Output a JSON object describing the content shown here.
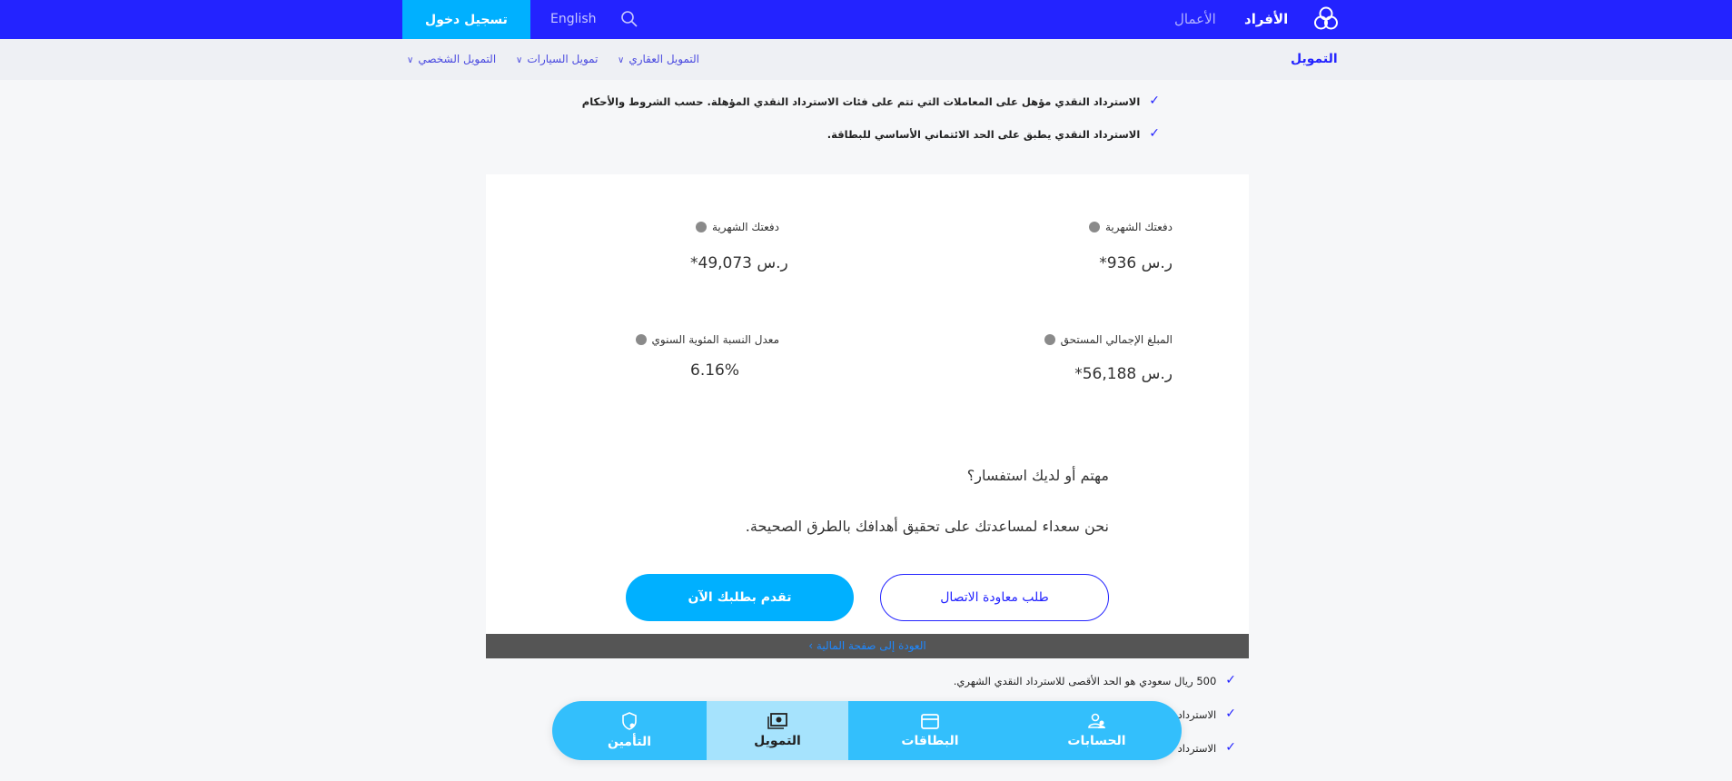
{
  "header": {
    "login": "تسجيل دخول",
    "language": "English",
    "tabs": [
      "الأفراد",
      "الأعمال"
    ]
  },
  "subnav": {
    "title": "التمويل",
    "items": [
      "التمويل العقاري",
      "تمويل السيارات",
      "التمويل الشخصي"
    ]
  },
  "top_bullets": [
    "الاسترداد النقدي مؤهل على المعاملات التي تتم على فئات الاسترداد النقدي المؤهلة. حسب الشروط والأحكام",
    "الاسترداد النقدي يطبق على الحد الائتماني الأساسي للبطاقة."
  ],
  "results": {
    "monthly_label": "دفعتك الشهرية",
    "monthly_value": "ر.س 936*",
    "monthly_label_2": "دفعتك الشهرية",
    "monthly_value_2": "ر.س 49,073*",
    "total_label": "المبلغ الإجمالي المستحق",
    "total_value": "ر.س 56,188*",
    "apr_label": "معدل النسبة المئوية السنوي",
    "apr_value": "6.16%"
  },
  "cta": {
    "question": "مهتم أو لديك استفسار؟",
    "text": "نحن سعداء لمساعدتك على تحقيق أهدافك بالطرق الصحيحة.",
    "callback": "طلب معاودة الاتصال",
    "apply": "تقدم بطلبك الآن"
  },
  "back_link": "العودة إلى صفحة المالية ›",
  "bottom_bullets": [
    "500 ريال سعودي هو الحد الأقصى للاسترداد النقدي الشهري.",
    "الاسترداد",
    "الاسترداد"
  ],
  "bottom_nav": {
    "items": [
      {
        "label": "الحسابات",
        "icon": "accounts-icon"
      },
      {
        "label": "البطاقات",
        "icon": "card-icon"
      },
      {
        "label": "التمويل",
        "icon": "finance-icon",
        "active": true
      },
      {
        "label": "التأمين",
        "icon": "insurance-icon"
      }
    ]
  },
  "colors": {
    "primary": "#2323ff",
    "accent": "#00b0ff",
    "nav": "#33bffc",
    "nav_active": "#a6e3fd"
  }
}
